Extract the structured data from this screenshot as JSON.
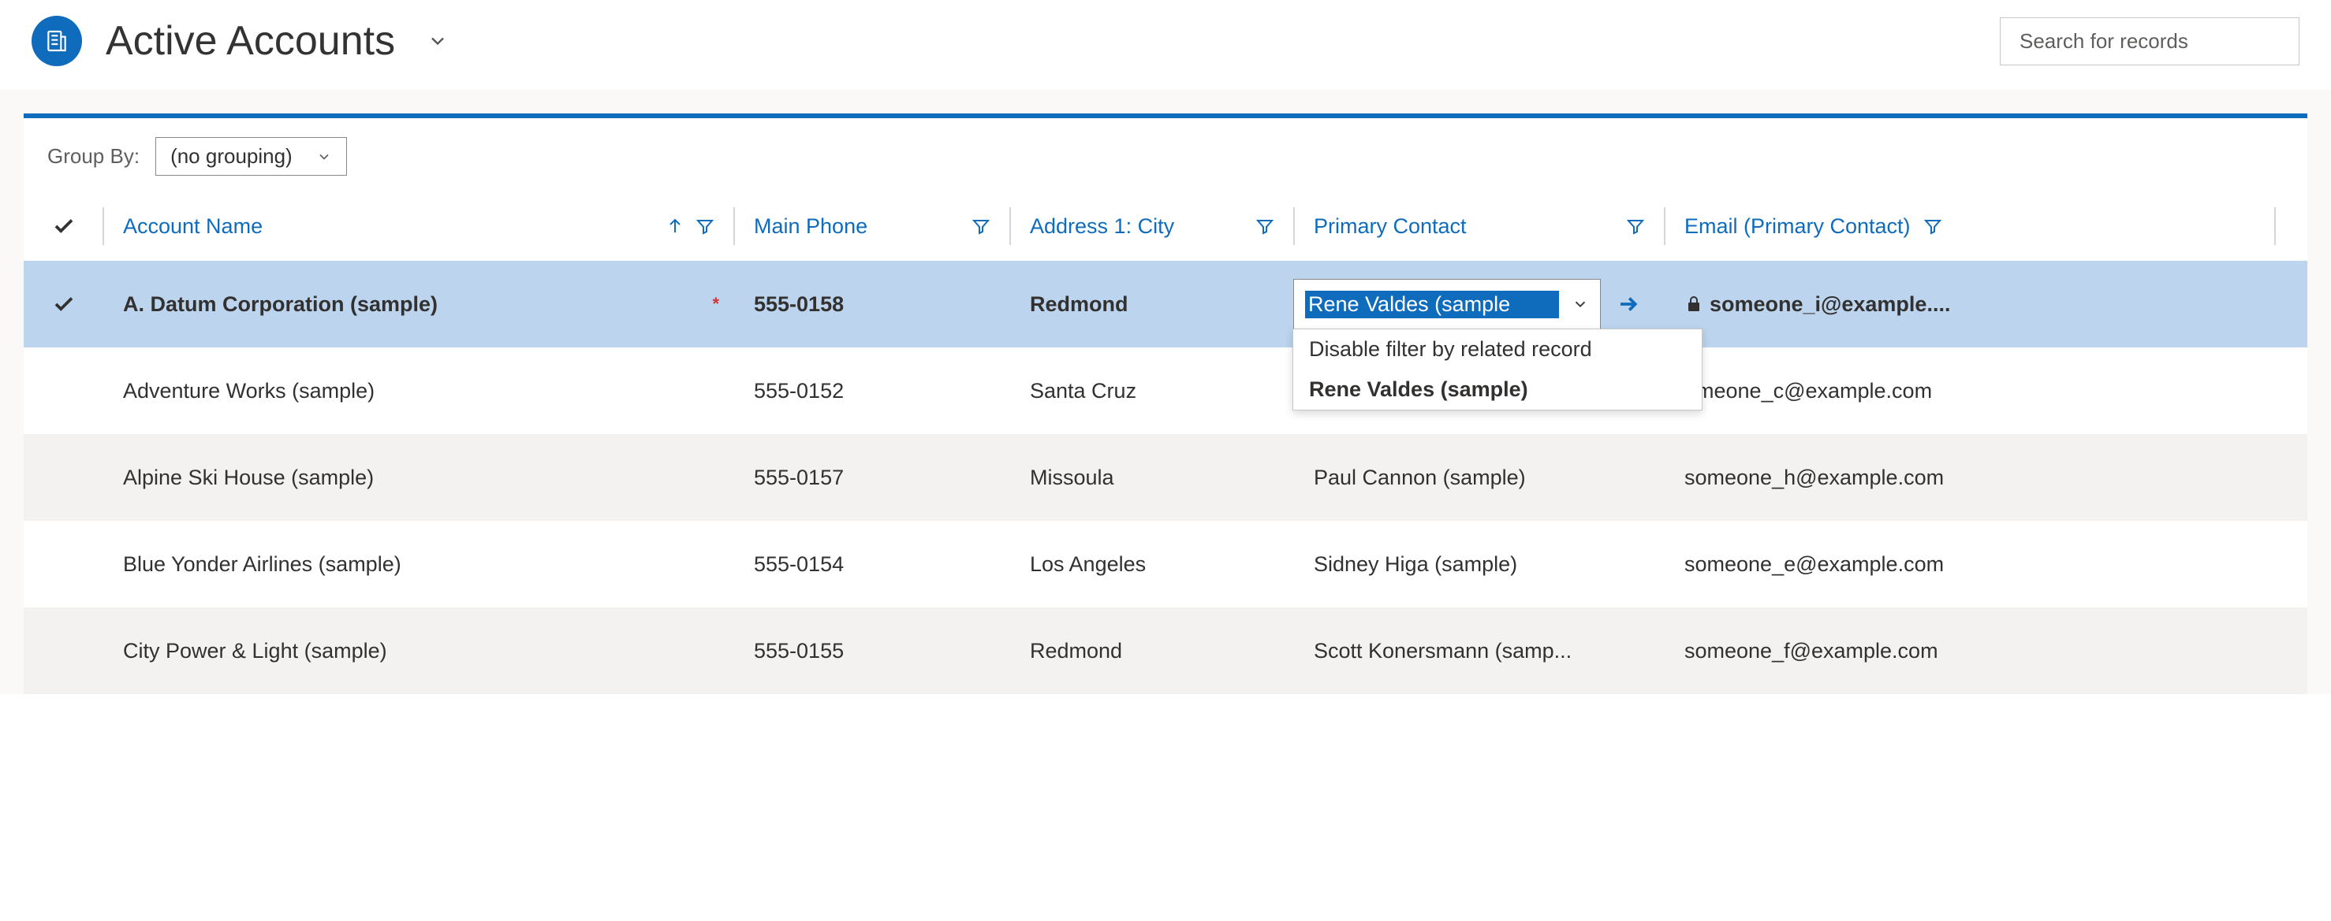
{
  "header": {
    "title": "Active Accounts",
    "search_placeholder": "Search for records"
  },
  "groupby": {
    "label": "Group By:",
    "value": "(no grouping)"
  },
  "columns": {
    "name": "Account Name",
    "phone": "Main Phone",
    "city": "Address 1: City",
    "contact": "Primary Contact",
    "email": "Email (Primary Contact)"
  },
  "rows": [
    {
      "name": "A. Datum Corporation (sample)",
      "phone": "555-0158",
      "city": "Redmond",
      "contact": "Rene Valdes (sample",
      "email": "someone_i@example....",
      "selected": true
    },
    {
      "name": "Adventure Works (sample)",
      "phone": "555-0152",
      "city": "Santa Cruz",
      "contact": "",
      "email": "omeone_c@example.com"
    },
    {
      "name": "Alpine Ski House (sample)",
      "phone": "555-0157",
      "city": "Missoula",
      "contact": "Paul Cannon (sample)",
      "email": "someone_h@example.com"
    },
    {
      "name": "Blue Yonder Airlines (sample)",
      "phone": "555-0154",
      "city": "Los Angeles",
      "contact": "Sidney Higa (sample)",
      "email": "someone_e@example.com"
    },
    {
      "name": "City Power & Light (sample)",
      "phone": "555-0155",
      "city": "Redmond",
      "contact": "Scott Konersmann (samp...",
      "email": "someone_f@example.com"
    }
  ],
  "dropdown": {
    "disable": "Disable filter by related record",
    "option1": "Rene Valdes (sample)"
  }
}
